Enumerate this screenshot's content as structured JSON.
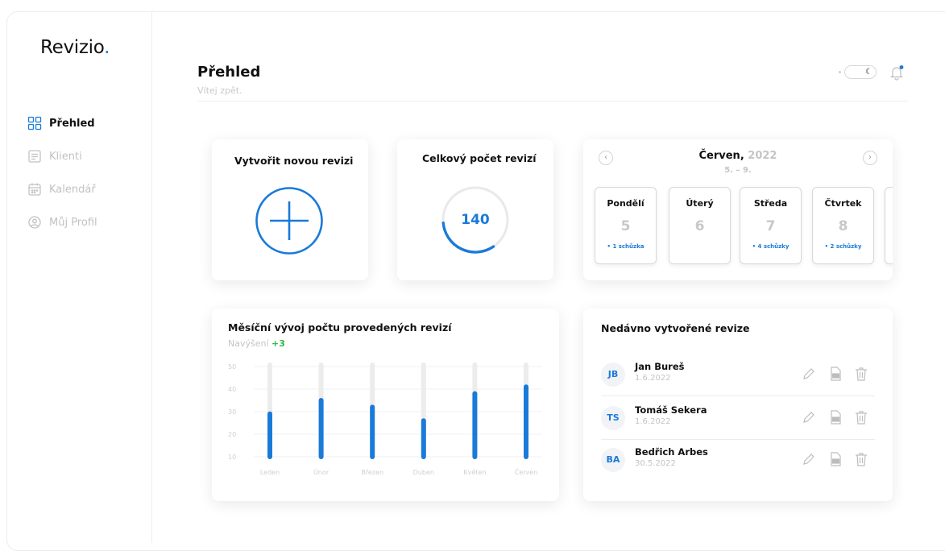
{
  "app": {
    "logo_text": "Revizio",
    "logo_dot": "."
  },
  "sidebar": {
    "items": [
      {
        "label": "Přehled",
        "icon": "dashboard-grid-icon",
        "active": true
      },
      {
        "label": "Klienti",
        "icon": "document-list-icon",
        "active": false
      },
      {
        "label": "Kalendář",
        "icon": "calendar-icon",
        "active": false
      },
      {
        "label": "Můj Profil",
        "icon": "user-circle-icon",
        "active": false
      }
    ]
  },
  "header": {
    "title": "Přehled",
    "subtitle": "Vítej zpět.",
    "theme_toggle_icon": "moon-icon",
    "notification_icon": "bell-icon"
  },
  "new_revision_card": {
    "title": "Vytvořit novou revizi",
    "icon": "plus-circle-icon"
  },
  "total_card": {
    "title": "Celkový počet revizí",
    "value": "140",
    "gauge_fraction": 0.33
  },
  "calendar": {
    "month": "Červen,",
    "year": "2022",
    "range": "5. – 9.",
    "prev_icon": "chevron-left-icon",
    "next_icon": "chevron-right-icon",
    "days": [
      {
        "name": "Pondělí",
        "num": "5",
        "meetings": "1 schůzka"
      },
      {
        "name": "Úterý",
        "num": "6",
        "meetings": ""
      },
      {
        "name": "Středa",
        "num": "7",
        "meetings": "4 schůzky"
      },
      {
        "name": "Čtvrtek",
        "num": "8",
        "meetings": "2 schůzky"
      }
    ]
  },
  "chart_card": {
    "title": "Měsíční vývoj počtu provedených revizí",
    "increase_label": "Navýšení",
    "increase_value": "+3"
  },
  "chart_data": {
    "type": "bar",
    "categories": [
      "Leden",
      "Únor",
      "Březen",
      "Duben",
      "Květen",
      "Červen"
    ],
    "values": [
      29,
      35,
      32,
      26,
      38,
      41
    ],
    "yticks": [
      10,
      20,
      30,
      40,
      50
    ],
    "ylim": [
      10,
      50
    ],
    "grid": true,
    "colors": {
      "bar": "#1a7ad9",
      "track": "#ececec"
    }
  },
  "recent": {
    "title": "Nedávno vytvořené revize",
    "items": [
      {
        "initials": "JB",
        "name": "Jan Bureš",
        "date": "1.6.2022"
      },
      {
        "initials": "TS",
        "name": "Tomáš Sekera",
        "date": "1.6.2022"
      },
      {
        "initials": "BA",
        "name": "Bedřich Arbes",
        "date": "30.5.2022"
      }
    ],
    "action_icons": [
      "pencil-edit-icon",
      "pdf-file-icon",
      "trash-icon"
    ]
  },
  "colors": {
    "accent": "#1a7ad9",
    "positive": "#2db84b",
    "muted": "#c4c4c4"
  }
}
